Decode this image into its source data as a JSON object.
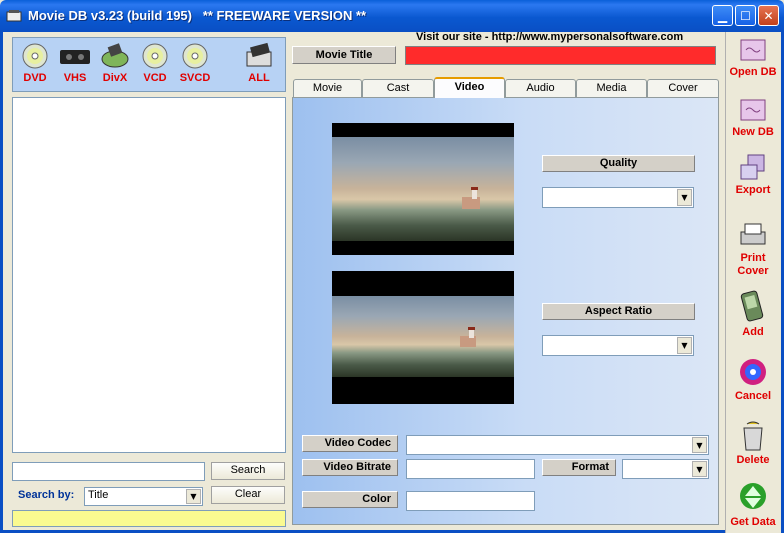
{
  "window": {
    "title": "Movie DB v3.23 (build 195)   ** FREEWARE VERSION **"
  },
  "media_types": [
    {
      "label": "DVD",
      "icon": "dvd-disc-icon"
    },
    {
      "label": "VHS",
      "icon": "vhs-tape-icon"
    },
    {
      "label": "DivX",
      "icon": "divx-disc-icon"
    },
    {
      "label": "VCD",
      "icon": "vcd-disc-icon"
    },
    {
      "label": "SVCD",
      "icon": "svcd-disc-icon"
    },
    {
      "label": "ALL",
      "icon": "all-media-icon"
    }
  ],
  "search": {
    "button_label": "Search",
    "clear_label": "Clear",
    "by_label": "Search by:",
    "by_value": "Title",
    "query_value": ""
  },
  "header": {
    "visit_text": "Visit our site - http://www.mypersonalsoftware.com",
    "movie_title_label": "Movie Title",
    "movie_title_value": ""
  },
  "tabs": [
    {
      "label": "Movie"
    },
    {
      "label": "Cast"
    },
    {
      "label": "Video",
      "active": true
    },
    {
      "label": "Audio"
    },
    {
      "label": "Media"
    },
    {
      "label": "Cover"
    }
  ],
  "video_tab": {
    "quality_label": "Quality",
    "quality_value": "",
    "aspect_label": "Aspect Ratio",
    "aspect_value": "",
    "codec_label": "Video Codec",
    "codec_value": "",
    "bitrate_label": "Video Bitrate",
    "bitrate_value": "",
    "format_label": "Format",
    "format_value": "",
    "color_label": "Color",
    "color_value": ""
  },
  "toolbar": [
    {
      "label": "Open DB",
      "icon": "open-db-icon"
    },
    {
      "label": "New DB",
      "icon": "new-db-icon"
    },
    {
      "label": "Export",
      "icon": "export-icon"
    },
    {
      "label": "Print Cover",
      "icon": "print-cover-icon"
    },
    {
      "label": "Add",
      "icon": "add-icon"
    },
    {
      "label": "Cancel",
      "icon": "cancel-icon"
    },
    {
      "label": "Delete",
      "icon": "delete-icon"
    },
    {
      "label": "Get Data",
      "icon": "get-data-icon"
    }
  ],
  "colors": {
    "accent_red": "#e00000",
    "title_field_bg": "#ff2b2b",
    "status_bar_bg": "#fafa90",
    "search_by_text": "#003399"
  }
}
